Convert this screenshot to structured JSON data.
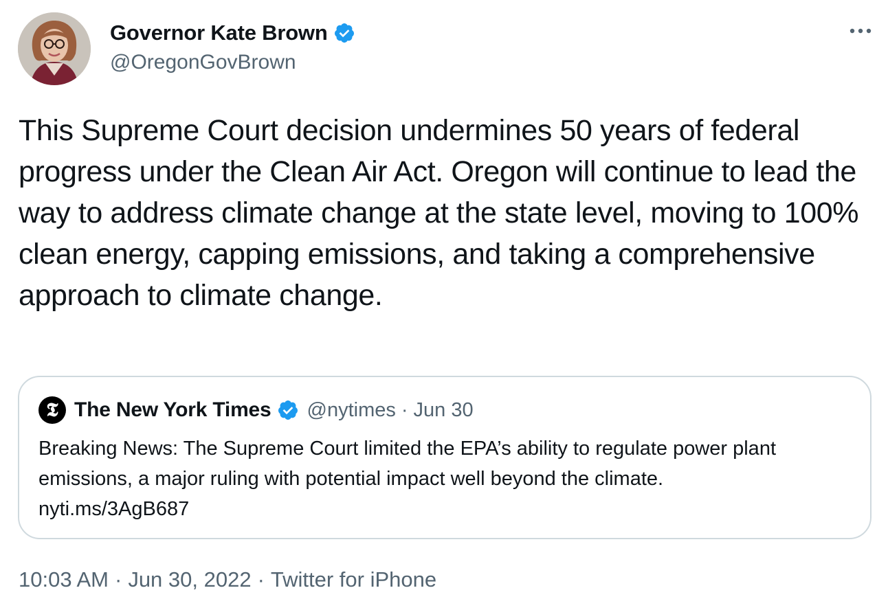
{
  "author": {
    "name": "Governor Kate Brown",
    "handle": "@OregonGovBrown",
    "verified": true
  },
  "tweet": {
    "text": "This Supreme Court decision undermines 50 years of federal progress under the Clean Air Act. Oregon will continue to lead the way to address climate change at the state level, moving to 100% clean energy, capping emissions, and taking a comprehensive approach to climate change."
  },
  "quoted_tweet": {
    "name": "The New York Times",
    "handle": "@nytimes",
    "separator": "·",
    "date": "Jun 30",
    "text": "Breaking News: The Supreme Court limited the EPA’s ability to regulate power plant emissions, a major ruling with potential impact well beyond the climate.",
    "link": "nyti.ms/3AgB687",
    "avatar_glyph": "𝕿"
  },
  "meta": {
    "time": "10:03 AM",
    "separator": "·",
    "date": "Jun 30, 2022",
    "source": "Twitter for iPhone"
  },
  "icons": {
    "more": "more-horizontal-icon",
    "verified": "verified-badge-icon"
  },
  "colors": {
    "verified_blue": "#1d9bf0",
    "secondary_text": "#536471",
    "primary_text": "#0f1419",
    "border": "#cfd9de"
  }
}
